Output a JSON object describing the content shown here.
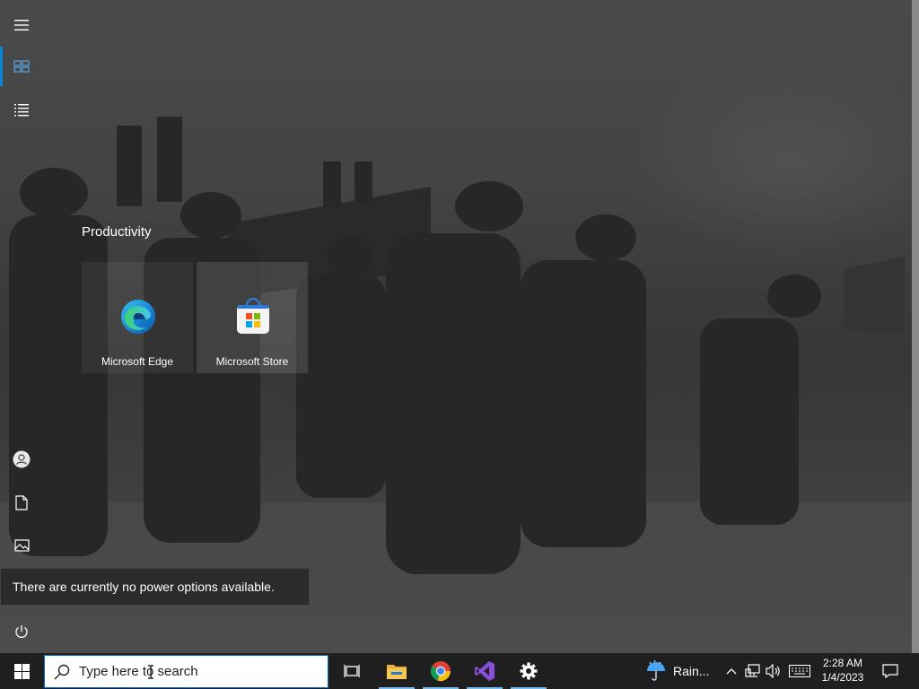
{
  "start_menu": {
    "group_title": "Productivity",
    "tiles": [
      {
        "label": "Microsoft Edge",
        "icon": "edge-icon"
      },
      {
        "label": "Microsoft Store",
        "icon": "store-icon"
      }
    ],
    "rail": {
      "top": [
        "hamburger-menu-icon",
        "pinned-tiles-icon",
        "all-apps-list-icon"
      ],
      "bottom": [
        "user-account-icon",
        "documents-icon",
        "pictures-icon",
        "power-icon"
      ]
    },
    "power_tooltip": "There are currently no power options available."
  },
  "taskbar": {
    "search_placeholder": "Type here to search",
    "pinned_apps": [
      "task-view-icon",
      "file-explorer-icon",
      "chrome-icon",
      "visual-studio-icon",
      "settings-icon"
    ],
    "weather_text": "Rain...",
    "clock": {
      "time": "2:28 AM",
      "date": "1/4/2023"
    },
    "tray_icons": [
      "show-hidden-icons-chevron-icon",
      "network-icon",
      "volume-icon",
      "touch-keyboard-icon",
      "action-center-icon"
    ]
  },
  "colors": {
    "accent": "#0a84d6",
    "taskbar_bg": "#1f1f1f",
    "active_indicator": "#76b9ed"
  }
}
